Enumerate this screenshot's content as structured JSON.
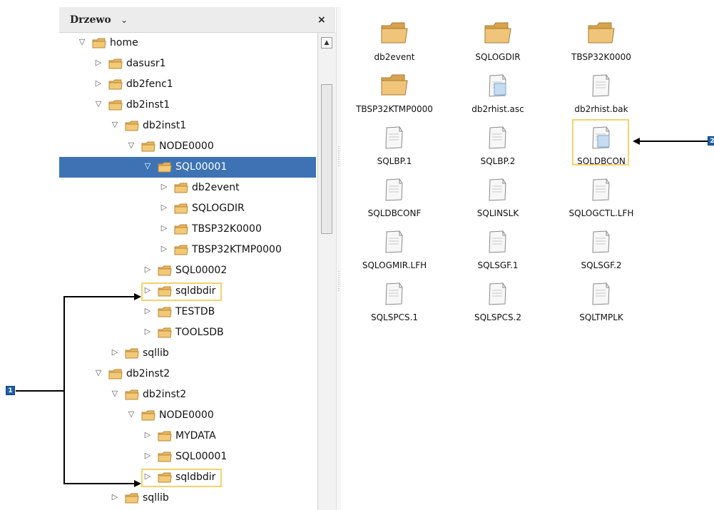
{
  "tree_panel": {
    "title": "Drzewo",
    "title_chevron_icon": "chevron-down-icon",
    "close_icon": "close-icon",
    "rows": [
      {
        "label": "home",
        "expanded": true,
        "selected": false,
        "highlighted": false
      },
      {
        "label": "dasusr1",
        "expanded": false,
        "selected": false,
        "highlighted": false
      },
      {
        "label": "db2fenc1",
        "expanded": false,
        "selected": false,
        "highlighted": false
      },
      {
        "label": "db2inst1",
        "expanded": true,
        "selected": false,
        "highlighted": false
      },
      {
        "label": "db2inst1",
        "expanded": true,
        "selected": false,
        "highlighted": false
      },
      {
        "label": "NODE0000",
        "expanded": true,
        "selected": false,
        "highlighted": false
      },
      {
        "label": "SQL00001",
        "expanded": true,
        "selected": true,
        "highlighted": false
      },
      {
        "label": "db2event",
        "expanded": false,
        "selected": false,
        "highlighted": false
      },
      {
        "label": "SQLOGDIR",
        "expanded": false,
        "selected": false,
        "highlighted": false
      },
      {
        "label": "TBSP32K0000",
        "expanded": false,
        "selected": false,
        "highlighted": false
      },
      {
        "label": "TBSP32KTMP0000",
        "expanded": false,
        "selected": false,
        "highlighted": false
      },
      {
        "label": "SQL00002",
        "expanded": false,
        "selected": false,
        "highlighted": false
      },
      {
        "label": "sqldbdir",
        "expanded": false,
        "selected": false,
        "highlighted": true
      },
      {
        "label": "TESTDB",
        "expanded": false,
        "selected": false,
        "highlighted": false
      },
      {
        "label": "TOOLSDB",
        "expanded": false,
        "selected": false,
        "highlighted": false
      },
      {
        "label": "sqllib",
        "expanded": false,
        "selected": false,
        "highlighted": false
      },
      {
        "label": "db2inst2",
        "expanded": true,
        "selected": false,
        "highlighted": false
      },
      {
        "label": "db2inst2",
        "expanded": true,
        "selected": false,
        "highlighted": false
      },
      {
        "label": "NODE0000",
        "expanded": true,
        "selected": false,
        "highlighted": false
      },
      {
        "label": "MYDATA",
        "expanded": false,
        "selected": false,
        "highlighted": false
      },
      {
        "label": "SQL00001",
        "expanded": false,
        "selected": false,
        "highlighted": false
      },
      {
        "label": "sqldbdir",
        "expanded": false,
        "selected": false,
        "highlighted": true
      },
      {
        "label": "sqllib",
        "expanded": false,
        "selected": false,
        "highlighted": false
      }
    ]
  },
  "file_view": {
    "items": [
      {
        "name": "db2event",
        "type": "folder",
        "highlighted": false
      },
      {
        "name": "SQLOGDIR",
        "type": "folder",
        "highlighted": false
      },
      {
        "name": "TBSP32K0000",
        "type": "folder",
        "highlighted": false
      },
      {
        "name": "TBSP32KTMP0000",
        "type": "folder",
        "highlighted": false
      },
      {
        "name": "db2rhist.asc",
        "type": "file-special",
        "highlighted": false
      },
      {
        "name": "db2rhist.bak",
        "type": "file",
        "highlighted": false
      },
      {
        "name": "SQLBP.1",
        "type": "file",
        "highlighted": false
      },
      {
        "name": "SQLBP.2",
        "type": "file",
        "highlighted": false
      },
      {
        "name": "SQLDBCON",
        "type": "file-special",
        "highlighted": true
      },
      {
        "name": "SQLDBCONF",
        "type": "file",
        "highlighted": false
      },
      {
        "name": "SQLINSLK",
        "type": "file",
        "highlighted": false
      },
      {
        "name": "SQLOGCTL.LFH",
        "type": "file",
        "highlighted": false
      },
      {
        "name": "SQLOGMIR.LFH",
        "type": "file",
        "highlighted": false
      },
      {
        "name": "SQLSGF.1",
        "type": "file",
        "highlighted": false
      },
      {
        "name": "SQLSGF.2",
        "type": "file",
        "highlighted": false
      },
      {
        "name": "SQLSPCS.1",
        "type": "file",
        "highlighted": false
      },
      {
        "name": "SQLSPCS.2",
        "type": "file",
        "highlighted": false
      },
      {
        "name": "SQLTMPLK",
        "type": "file",
        "highlighted": false
      }
    ]
  },
  "callouts": {
    "left_badge": "1",
    "right_badge": "2"
  },
  "colors": {
    "selection": "#3d73b5",
    "highlight_border": "#f5d26b",
    "folder_fill": "#e8b55e",
    "callout_badge": "#1f5fa5"
  }
}
